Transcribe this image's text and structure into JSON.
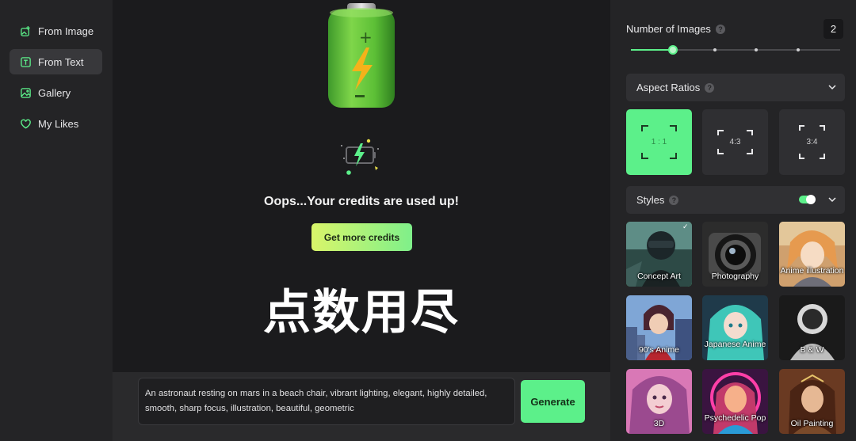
{
  "sidebar": {
    "items": [
      {
        "label": "From Image",
        "icon": "image-plus-icon",
        "active": false
      },
      {
        "label": "From Text",
        "icon": "text-box-icon",
        "active": true
      },
      {
        "label": "Gallery",
        "icon": "gallery-icon",
        "active": false
      },
      {
        "label": "My Likes",
        "icon": "heart-icon",
        "active": false
      }
    ]
  },
  "main": {
    "message": "Oops...Your credits are used up!",
    "credits_button": "Get more credits",
    "overlay_text": "点数用尽",
    "prompt": "An astronaut resting on mars in a beach chair, vibrant lighting, elegant, highly detailed, smooth, sharp focus, illustration, beautiful, geometric",
    "generate_button": "Generate"
  },
  "panel": {
    "number_of_images_label": "Number of Images",
    "number_of_images_value": "2",
    "slider_fraction": 0.2,
    "aspect_ratios_label": "Aspect Ratios",
    "ratios": [
      {
        "label": "1 : 1",
        "selected": true
      },
      {
        "label": "4:3",
        "selected": false
      },
      {
        "label": "3:4",
        "selected": false
      }
    ],
    "styles_label": "Styles",
    "styles_toggle_on": true,
    "styles": [
      {
        "label": "Concept Art",
        "selected": true
      },
      {
        "label": "Photography",
        "selected": false
      },
      {
        "label": "Anime illustration",
        "selected": false
      },
      {
        "label": "90's Anime",
        "selected": false
      },
      {
        "label": "Japanese Anime",
        "selected": false
      },
      {
        "label": "B & W",
        "selected": false
      },
      {
        "label": "3D",
        "selected": false
      },
      {
        "label": "Psychedelic Pop",
        "selected": false
      },
      {
        "label": "Oil Painting",
        "selected": false
      }
    ]
  },
  "colors": {
    "accent": "#5cf08a",
    "background": "#1b1b1d",
    "panel": "#242426"
  }
}
